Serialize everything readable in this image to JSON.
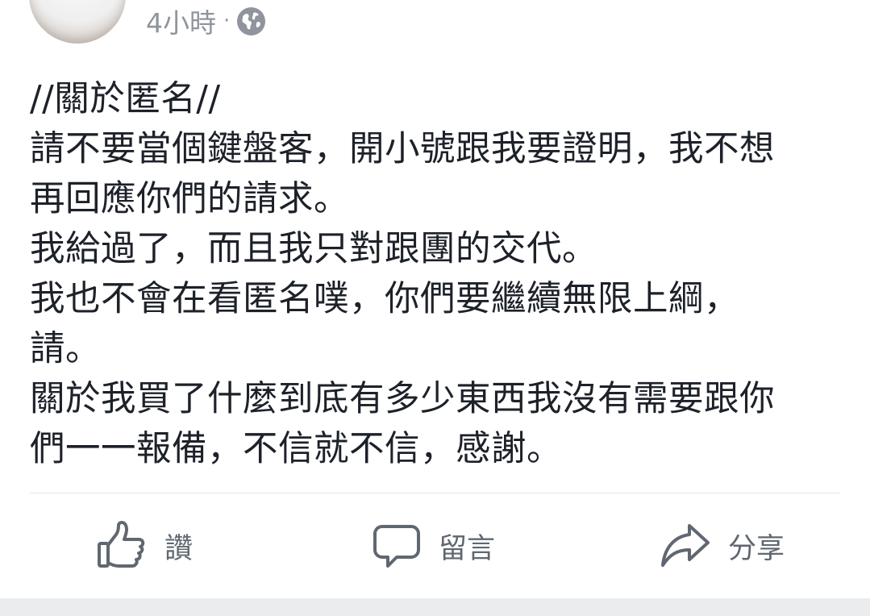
{
  "post": {
    "timestamp": "4小時",
    "separator": "·",
    "privacy_icon": "globe-icon",
    "lines": [
      "//關於匿名//",
      "請不要當個鍵盤客，開小號跟我要證明，我不想",
      "再回應你們的請求。",
      "我給過了，而且我只對跟團的交代。",
      "我也不會在看匿名噗，你們要繼續無限上綱，",
      "請。",
      "關於我買了什麼到底有多少東西我沒有需要跟你",
      "們一一報備，不信就不信，感謝。"
    ]
  },
  "actions": {
    "like": {
      "label": "讚",
      "icon": "thumbs-up-icon"
    },
    "comment": {
      "label": "留言",
      "icon": "speech-bubble-icon"
    },
    "share": {
      "label": "分享",
      "icon": "share-arrow-icon"
    }
  },
  "colors": {
    "text": "#1d2129",
    "meta": "#90949c",
    "action": "#606770",
    "divider": "#e5e6e9",
    "background": "#ffffff",
    "band": "#ebecee"
  }
}
